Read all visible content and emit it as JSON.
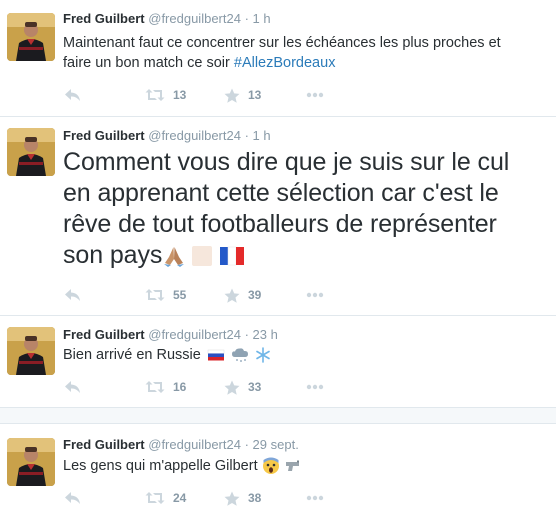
{
  "tweets": [
    {
      "name": "Fred Guilbert",
      "handle": "@fredguilbert24",
      "separator": "·",
      "time": "1 h",
      "text_line1": "Maintenant faut ce concentrer sur les échéances les plus proches et",
      "text_line2": "faire un bon match ce soir ",
      "hashtag": "#AllezBordeaux",
      "retweets": "13",
      "favorites": "13"
    },
    {
      "name": "Fred Guilbert",
      "handle": "@fredguilbert24",
      "separator": "·",
      "time": "1 h",
      "text_line1": "Comment vous dire que je suis sur le cul",
      "text_line2": "en apprenant cette sélection car c'est le",
      "text_line3": "rêve de tout footballeurs de représenter",
      "text_line4": "son pays",
      "retweets": "55",
      "favorites": "39"
    },
    {
      "name": "Fred Guilbert",
      "handle": "@fredguilbert24",
      "separator": "·",
      "time": "23 h",
      "text": "Bien arrivé en Russie",
      "retweets": "16",
      "favorites": "33"
    },
    {
      "name": "Fred Guilbert",
      "handle": "@fredguilbert24",
      "separator": "·",
      "time": "29 sept.",
      "text": "Les gens qui m'appelle Gilbert",
      "retweets": "24",
      "favorites": "38"
    }
  ],
  "icons": {
    "reply": "reply-icon",
    "retweet": "retweet-icon",
    "favorite": "star-icon",
    "more": "more-icon"
  },
  "colors": {
    "text": "#292f33",
    "muted": "#8899a6",
    "hashtag": "#2b7bb9",
    "border": "#e1e8ed"
  }
}
